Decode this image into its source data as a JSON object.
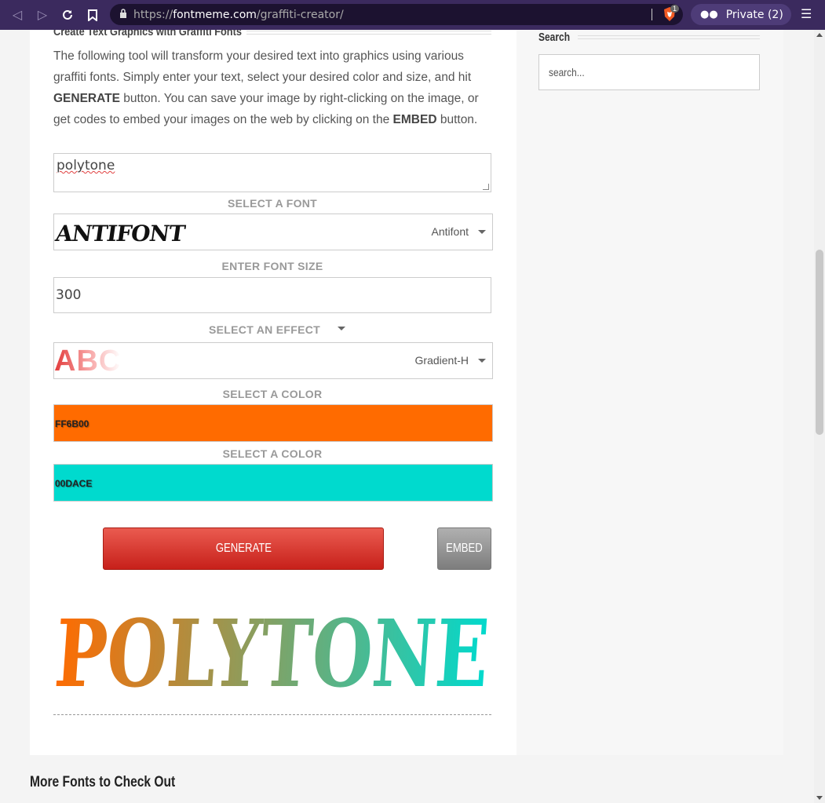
{
  "browser": {
    "url_scheme": "https://",
    "url_host": "fontmeme.com",
    "url_path": "/graffiti-creator/",
    "shields_count": "1",
    "private_label": "Private (2)",
    "icons": [
      "back-icon",
      "forward-icon",
      "reload-icon",
      "bookmark-icon",
      "lock-icon",
      "brave-shield-icon",
      "private-glasses-icon",
      "menu-icon"
    ]
  },
  "main": {
    "heading": "Create Text Graphics with Graffiti Fonts",
    "intro_1": "The following tool will transform your desired text into graphics using various graffiti fonts. Simply enter your text, select your desired color and size, and hit ",
    "intro_generate": "GENERATE",
    "intro_2": " button. You can save your image by right-clicking on the image, or get codes to embed your images on the web by clicking on the ",
    "intro_embed": "EMBED",
    "intro_3": " button.",
    "text_value": "polytone",
    "font_label": "SELECT A FONT",
    "font_value": "Antifont",
    "font_preview": "ANTIFONT",
    "size_label": "ENTER FONT SIZE",
    "size_value": "300",
    "effect_label": "SELECT AN EFFECT",
    "effect_value": "Gradient-H",
    "effect_preview": "ABC",
    "color1_label": "SELECT A COLOR",
    "color1_value": "FF6B00",
    "color2_label": "SELECT A COLOR",
    "color2_value": "00DACE",
    "generate_label": "GENERATE",
    "embed_label": "EMBED",
    "result_text": "POLYTONE"
  },
  "colors": {
    "color1": "#FF6B00",
    "color2": "#00DACE",
    "browser_bg": "#3b2a5e"
  },
  "sidebar": {
    "search_title": "Search",
    "search_placeholder": "search..."
  },
  "more_title": "More Fonts to Check Out"
}
